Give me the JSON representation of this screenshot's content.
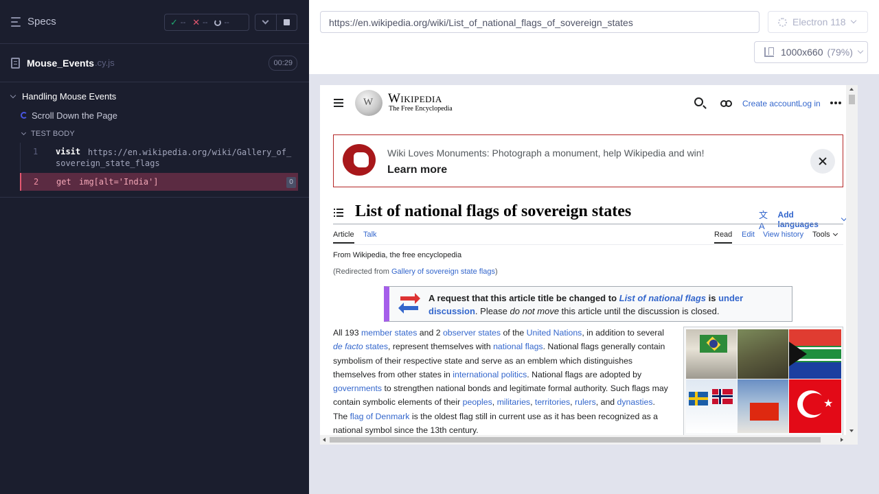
{
  "runner": {
    "specs_label": "Specs",
    "stats": {
      "passed": "--",
      "failed": "--",
      "pending": "--"
    },
    "file": {
      "name": "Mouse_Events",
      "ext": ".cy.js",
      "duration": "00:29"
    },
    "suite": {
      "title": "Handling Mouse Events",
      "test_title": "Scroll Down the Page",
      "body_label": "TEST BODY",
      "commands": [
        {
          "num": "1",
          "name": "visit",
          "message": "https://en.wikipedia.org/wiki/Gallery_of_",
          "message_cont": "sovereign_state_flags"
        },
        {
          "num": "2",
          "name": "get",
          "message": "img[alt='India']",
          "count": "0"
        }
      ]
    }
  },
  "browser": {
    "url": "https://en.wikipedia.org/wiki/List_of_national_flags_of_sovereign_states",
    "browser_name": "Electron 118",
    "viewport": "1000x660",
    "zoom": "(79%)"
  },
  "wiki": {
    "wordmark": "Wikipedia",
    "tagline": "The Free Encyclopedia",
    "create_account": "Create account",
    "login": "Log in",
    "banner": {
      "text": "Wiki Loves Monuments: Photograph a monument, help Wikipedia and win!",
      "link": "Learn more"
    },
    "title": "List of national flags of sovereign states",
    "add_languages": "Add languages",
    "tabs": {
      "article": "Article",
      "talk": "Talk",
      "read": "Read",
      "edit": "Edit",
      "view_history": "View history",
      "tools": "Tools"
    },
    "from": "From Wikipedia, the free encyclopedia",
    "redirect": {
      "prefix": "(Redirected from ",
      "link": "Gallery of sovereign state flags",
      "suffix": ")"
    },
    "notice": {
      "bold_start": "A request that this article title be changed to ",
      "bold_link": "List of national flags",
      "bold_is": " is ",
      "under_link": "under",
      "discussion_link": "discussion",
      "rest_1": ". Please ",
      "italic": "do not move",
      "rest_2": " this article until the discussion is closed."
    },
    "paragraph": {
      "t1": "All 193 ",
      "l1": "member states",
      "t2": " and 2 ",
      "l2": "observer states",
      "t3": " of the ",
      "l3": "United Nations",
      "t4": ", in addition to several ",
      "l4": "de facto",
      "l4b": " states",
      "t5": ", represent themselves with ",
      "l5": "national flags",
      "t6": ". National flags generally contain symbolism of their respective state and serve as an emblem which distinguishes themselves from other states in ",
      "l6": "international politics",
      "t7": ". National flags are adopted by ",
      "l7": "governments",
      "t8": " to strengthen national bonds and legitimate formal authority. Such flags may contain symbolic elements of their ",
      "l8": "peoples",
      "l9": "militaries",
      "l10": "territories",
      "l11": "rulers",
      "t9": ", and ",
      "l12": "dynasties",
      "t10": ". The ",
      "l13": "flag of Denmark",
      "t11": " is the oldest flag still in current use as it has been recognized as a national symbol since the 13th century."
    }
  }
}
